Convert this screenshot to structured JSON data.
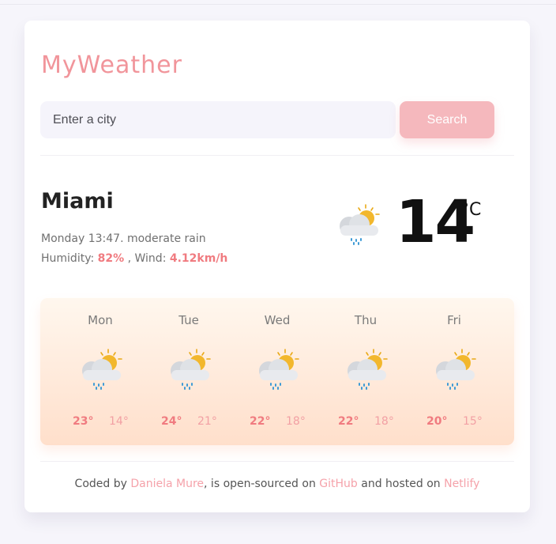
{
  "app": {
    "title": "MyWeather"
  },
  "search": {
    "placeholder": "Enter a city",
    "button_label": "Search"
  },
  "current": {
    "city": "Miami",
    "datetime_description": "Monday 13:47. moderate rain",
    "humidity_label": "Humidity:",
    "humidity_value": "82%",
    "wind_separator": ", Wind:",
    "wind_value": "4.12km/h",
    "temperature": "14",
    "unit": "°C",
    "icon": "sun-cloud-rain-icon"
  },
  "forecast": [
    {
      "day": "Mon",
      "max": "23°",
      "min": "14°",
      "icon": "sun-cloud-rain-icon"
    },
    {
      "day": "Tue",
      "max": "24°",
      "min": "21°",
      "icon": "sun-cloud-rain-icon"
    },
    {
      "day": "Wed",
      "max": "22°",
      "min": "18°",
      "icon": "sun-cloud-rain-icon"
    },
    {
      "day": "Thu",
      "max": "22°",
      "min": "18°",
      "icon": "sun-cloud-rain-icon"
    },
    {
      "day": "Fri",
      "max": "20°",
      "min": "15°",
      "icon": "sun-cloud-rain-icon"
    }
  ],
  "footer": {
    "prefix": "Coded by",
    "author": "Daniela Mure",
    "middle": ", is open-sourced on",
    "repo_link": "GitHub",
    "hosted_text": "and hosted on",
    "host_link": "Netlify"
  },
  "colors": {
    "brand_pink": "#f1959b",
    "accent_red": "#f07b80",
    "button_bg": "#f5b8bd",
    "page_bg": "#f6f5fb",
    "forecast_gradient_top": "#fff7ee",
    "forecast_gradient_bottom": "#ffdfcb"
  }
}
